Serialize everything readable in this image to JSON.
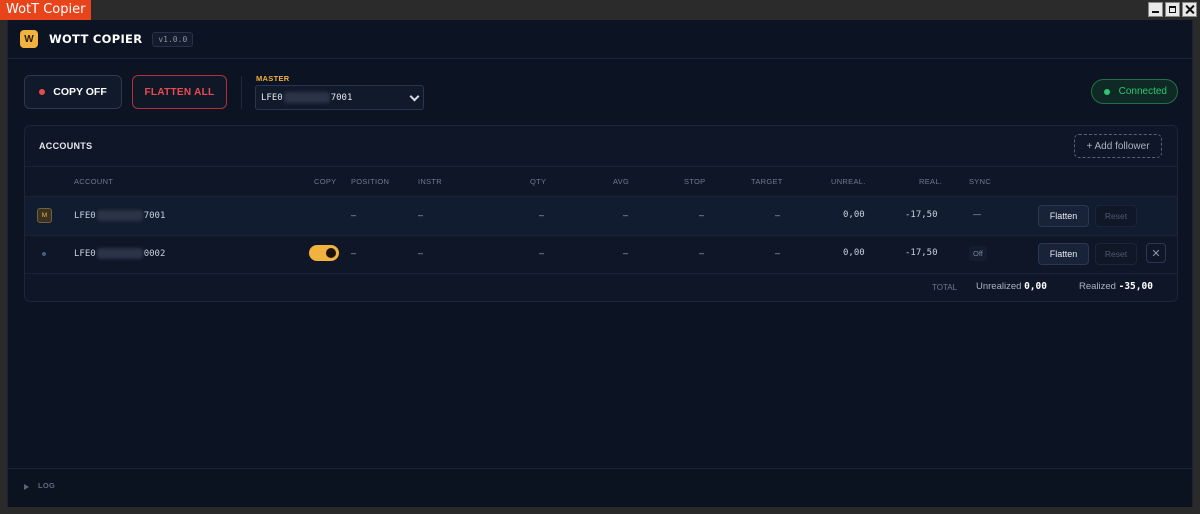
{
  "window": {
    "title": "WotT Copier"
  },
  "header": {
    "logo_letter": "W",
    "app_name": "WOTT COPIER",
    "version": "v1.0.0"
  },
  "toolbar": {
    "copy_label": "COPY OFF",
    "flatten_all_label": "FLATTEN ALL",
    "master_label": "MASTER",
    "master_prefix": "LFE0",
    "master_suffix": "7001",
    "connection_status": "Connected"
  },
  "accounts": {
    "title": "ACCOUNTS",
    "add_follower_label": "+ Add follower",
    "columns": [
      "ACCOUNT",
      "COPY",
      "POSITION",
      "INSTR",
      "QTY",
      "AVG",
      "STOP",
      "TARGET",
      "UNREAL.",
      "REAL.",
      "SYNC"
    ],
    "rows": [
      {
        "role_badge": "M",
        "account_prefix": "LFE0",
        "account_suffix": "7001",
        "position": "–",
        "instr": "–",
        "qty": "–",
        "avg": "–",
        "stop": "–",
        "target": "–",
        "unrealized": "0,00",
        "realized": "-17,50",
        "sync": "—",
        "flatten_label": "Flatten",
        "reset_label": "Reset"
      },
      {
        "account_prefix": "LFE0",
        "account_suffix": "0002",
        "copy_enabled": true,
        "position": "–",
        "instr": "–",
        "qty": "–",
        "avg": "–",
        "stop": "–",
        "target": "–",
        "unrealized": "0,00",
        "realized": "-17,50",
        "sync": "Off",
        "flatten_label": "Flatten",
        "reset_label": "Reset",
        "remove_label": "✕"
      }
    ],
    "totals": {
      "label": "TOTAL",
      "unrealized_label": "Unrealized",
      "unrealized": "0,00",
      "realized_label": "Realized",
      "realized": "-35,00"
    }
  },
  "log": {
    "label": "LOG"
  },
  "colors": {
    "accent": "#f1b23f",
    "danger": "#ea4b53",
    "success": "#2fc574",
    "background": "#0c1322"
  }
}
